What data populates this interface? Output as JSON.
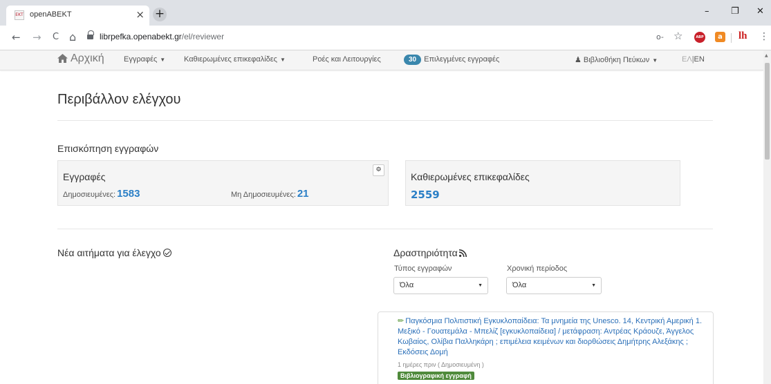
{
  "browser": {
    "tab_title": "openABEKT",
    "tab_favicon_text": "ΕΚΤ",
    "tab_close_glyph": "×",
    "new_tab_glyph": "+",
    "url_host": "librpefka.openabekt.gr",
    "url_path": "/el/reviewer",
    "window": {
      "minimize": "–",
      "maximize": "❐",
      "close": "✕"
    },
    "nav": {
      "back": "←",
      "forward": "→",
      "reload": "C",
      "home": "⌂"
    },
    "key_icon_glyph": "o-",
    "star_glyph": "☆",
    "abp_label": "ABP",
    "ext2_label": "a",
    "ext3_label": "lh",
    "menu_glyph": "⋮"
  },
  "site_nav": {
    "home_label": "Αρχική",
    "records_label": "Εγγραφές",
    "authority_headings_label": "Καθιερωμένες επικεφαλίδες",
    "workflows_label": "Ροές και Λειτουργίες",
    "selected_count": "30",
    "selected_label": "Επιλεγμένες εγγραφές",
    "user_label": "Βιβλιοθήκη Πεύκων",
    "lang_el": "ΕΛ",
    "lang_sep": "|",
    "lang_en": "EN"
  },
  "page": {
    "title": "Περιβάλλον ελέγχου",
    "overview_title": "Επισκόπηση εγγραφών",
    "records_box": {
      "heading": "Εγγραφές",
      "published_label": "Δημοσιευμένες:",
      "published_value": "1583",
      "unpublished_label": "Μη Δημοσιευμένες:",
      "unpublished_value": "21"
    },
    "authority_box": {
      "heading": "Καθιερωμένες επικεφαλίδες",
      "value": "2559"
    },
    "new_requests_title": "Νέα αιτήματα για έλεγχο",
    "activity": {
      "title": "Δραστηριότητα",
      "record_type_label": "Τύπος εγγραφών",
      "record_type_value": "Όλα",
      "period_label": "Χρονική περίοδος",
      "period_value": "Όλα",
      "items": [
        {
          "text": "Παγκόσμια Πολιτιστική Εγκυκλοπαίδεια: Τα μνημεία της Unesco. 14, Κεντρική Αμερική 1. Μεξικό - Γουατεμάλα - Μπελίζ [εγκυκλοπαίδεια] / μετάφραση: Αντρέας Κράουζε, Άγγελος Κωβαίος, Ολίβια Παλληκάρη ; επιμέλεια κειμένων και διορθώσεις Δημήτρης Αλεξάκης ; Εκδόσεις Δομή",
          "meta": "1 ημέρες πριν ( Δημοσιευμένη )",
          "tag": "Βιβλιογραφική εγγραφή"
        }
      ]
    }
  },
  "colors": {
    "link": "#2a7fc6",
    "badge": "#3a87ad",
    "tag_green": "#4f8a3b"
  }
}
